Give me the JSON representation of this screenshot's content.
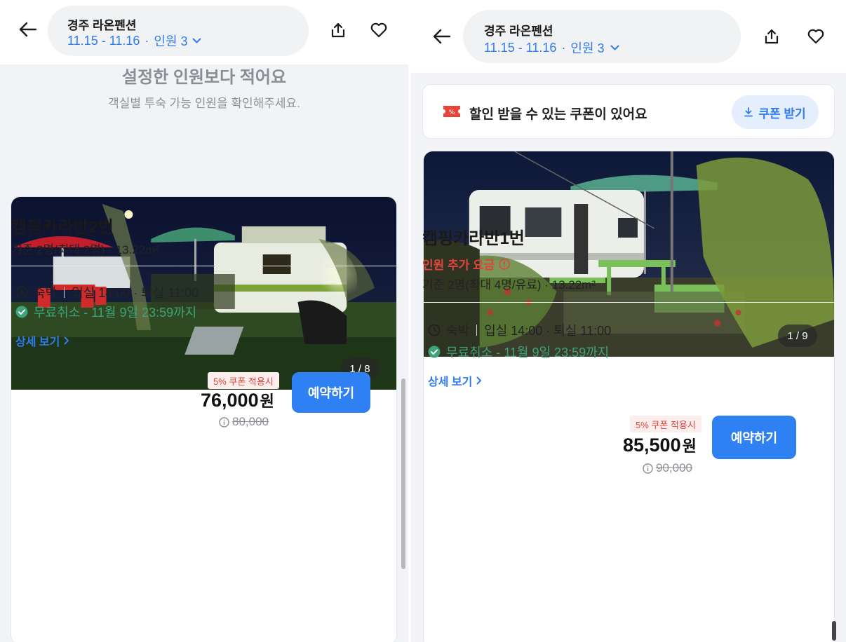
{
  "left": {
    "header": {
      "title": "경주 라온펜션",
      "dates": "11.15 - 11.16",
      "separator": "·",
      "guests": "인원 3"
    },
    "notice": {
      "title": "설정한 인원보다 적어요",
      "subtitle": "객실별 투숙 가능 인원을 확인해주세요."
    },
    "room": {
      "photo_counter": "1 / 8",
      "name": "캠핑카라반2번",
      "capacity": "기준 2명(최대 2명) · 13.22m²",
      "stay_type": "숙박",
      "check_times": "입실 14:00 · 퇴실 11:00",
      "cancel": "무료취소 - 11월 9일 23:59까지",
      "detail_link": "상세 보기",
      "coupon_tag": "5% 쿠폰 적용시",
      "price": "76,000",
      "price_unit": "원",
      "original_price": "80,000",
      "book_label": "예약하기"
    }
  },
  "right": {
    "header": {
      "title": "경주 라온펜션",
      "dates": "11.15 - 11.16",
      "separator": "·",
      "guests": "인원 3"
    },
    "coupon_banner": {
      "text": "할인 받을 수 있는 쿠폰이 있어요",
      "button": "쿠폰 받기"
    },
    "room": {
      "photo_counter": "1 / 9",
      "name": "캠핑카라반1번",
      "extra_fee": "인원 추가 요금",
      "capacity": "기준 2명(최대 4명/유료) · 13.22m²",
      "stay_type": "숙박",
      "check_times": "입실 14:00 · 퇴실 11:00",
      "cancel": "무료취소 - 11월 9일 23:59까지",
      "detail_link": "상세 보기",
      "coupon_tag": "5% 쿠폰 적용시",
      "price": "85,500",
      "price_unit": "원",
      "original_price": "90,000",
      "book_label": "예약하기"
    }
  },
  "icons": [
    "back-arrow-icon",
    "chevron-down-icon",
    "share-icon",
    "heart-icon",
    "coupon-icon",
    "download-icon",
    "clock-icon",
    "check-circle-icon",
    "info-icon",
    "chevron-right-icon"
  ],
  "colors": {
    "accent": "#2f7bf0",
    "button": "#2f80f2",
    "cancel_green": "#3ea37a",
    "warning_red": "#e0453a"
  }
}
